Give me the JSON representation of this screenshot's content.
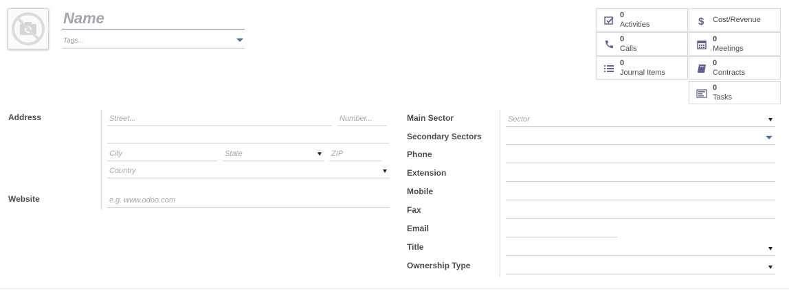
{
  "header": {
    "name_placeholder": "Name",
    "tags_placeholder": "Tags..."
  },
  "smart_buttons": [
    {
      "id": "activities",
      "count": "0",
      "label": "Activities",
      "icon": "check-square-icon"
    },
    {
      "id": "cost_revenue",
      "count": "",
      "label": "Cost/Revenue",
      "icon": "dollar-icon"
    },
    {
      "id": "calls",
      "count": "0",
      "label": "Calls",
      "icon": "phone-icon"
    },
    {
      "id": "meetings",
      "count": "0",
      "label": "Meetings",
      "icon": "calendar-icon"
    },
    {
      "id": "journal_items",
      "count": "0",
      "label": "Journal Items",
      "icon": "list-icon"
    },
    {
      "id": "contracts",
      "count": "0",
      "label": "Contracts",
      "icon": "book-icon"
    },
    {
      "id": "tasks",
      "count": "0",
      "label": "Tasks",
      "icon": "tasks-icon"
    }
  ],
  "left": {
    "address_label": "Address",
    "website_label": "Website",
    "street_placeholder": "Street...",
    "number_placeholder": "Number...",
    "city_placeholder": "City",
    "state_placeholder": "State",
    "zip_placeholder": "ZIP",
    "country_placeholder": "Country",
    "website_placeholder": "e.g. www.odoo.com"
  },
  "right": {
    "main_sector_label": "Main Sector",
    "main_sector_placeholder": "Sector",
    "secondary_sectors_label": "Secondary Sectors",
    "phone_label": "Phone",
    "extension_label": "Extension",
    "mobile_label": "Mobile",
    "fax_label": "Fax",
    "email_label": "Email",
    "title_label": "Title",
    "ownership_type_label": "Ownership Type"
  },
  "colors": {
    "accent": "#7c7bad",
    "icon": "#5f5e97",
    "dropdown_blue": "#4a6fa5"
  }
}
